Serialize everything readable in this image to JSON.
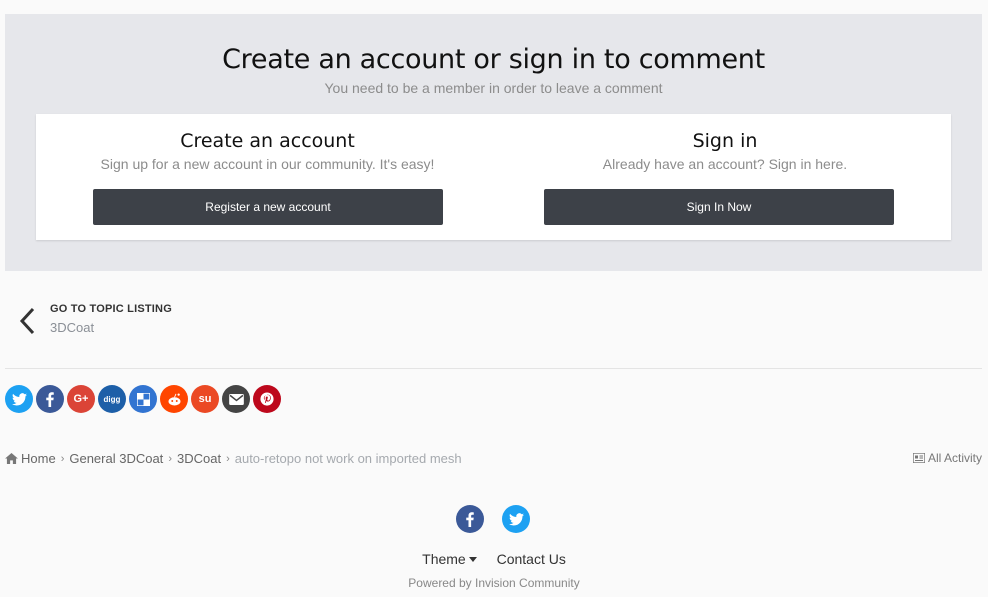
{
  "signin_panel": {
    "title": "Create an account or sign in to comment",
    "subtitle": "You need to be a member in order to leave a comment",
    "create": {
      "title": "Create an account",
      "subtitle": "Sign up for a new account in our community. It's easy!",
      "button": "Register a new account"
    },
    "signin": {
      "title": "Sign in",
      "subtitle": "Already have an account? Sign in here.",
      "button": "Sign In Now"
    }
  },
  "topic_nav": {
    "label": "GO TO TOPIC LISTING",
    "forum": "3DCoat"
  },
  "share": [
    {
      "icon": "twitter-icon",
      "color": "#1da1f2"
    },
    {
      "icon": "facebook-icon",
      "color": "#3b5998"
    },
    {
      "icon": "google-plus-icon",
      "color": "#db4437"
    },
    {
      "icon": "digg-icon",
      "color": "#1d5fa8"
    },
    {
      "icon": "delicious-icon",
      "color": "#3274d1"
    },
    {
      "icon": "reddit-icon",
      "color": "#ff4500"
    },
    {
      "icon": "stumbleupon-icon",
      "color": "#eb4924"
    },
    {
      "icon": "email-icon",
      "color": "#444444"
    },
    {
      "icon": "pinterest-icon",
      "color": "#bd081c"
    }
  ],
  "breadcrumb": {
    "home": "Home",
    "items": [
      "General 3DCoat",
      "3DCoat"
    ],
    "current": "auto-retopo not work on imported mesh"
  },
  "all_activity": "All Activity",
  "footer": {
    "theme": "Theme",
    "contact": "Contact Us",
    "powered": "Powered by Invision Community",
    "social": [
      {
        "icon": "facebook-icon",
        "color": "#3b5998"
      },
      {
        "icon": "twitter-icon",
        "color": "#1da1f2"
      }
    ]
  }
}
